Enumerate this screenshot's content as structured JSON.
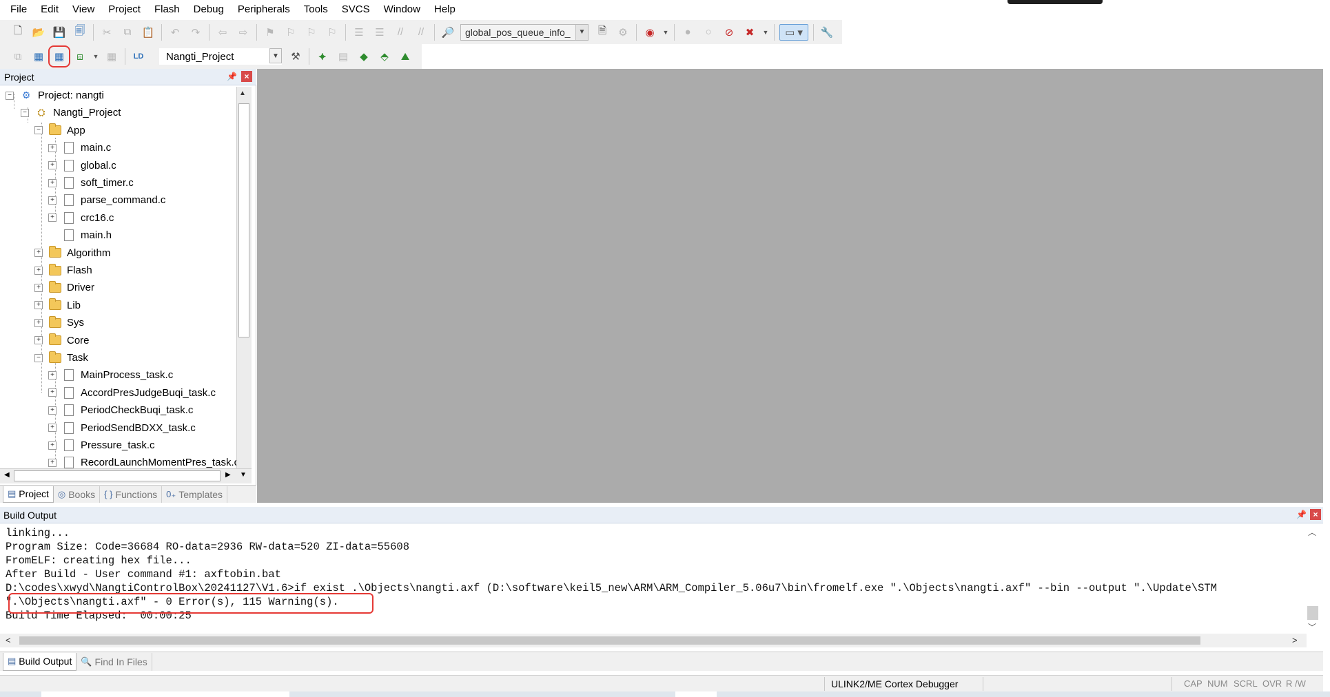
{
  "menu": [
    "File",
    "Edit",
    "View",
    "Project",
    "Flash",
    "Debug",
    "Peripherals",
    "Tools",
    "SVCS",
    "Window",
    "Help"
  ],
  "toolbar": {
    "find_combo_value": "global_pos_queue_info_",
    "target_combo_value": "Nangti_Project"
  },
  "project_panel": {
    "title": "Project",
    "tree": [
      {
        "label": "Project: nangti",
        "depth": 0,
        "type": "project",
        "exp": "−"
      },
      {
        "label": "Nangti_Project",
        "depth": 1,
        "type": "target",
        "exp": "−"
      },
      {
        "label": "App",
        "depth": 2,
        "type": "folder-open",
        "exp": "−"
      },
      {
        "label": "main.c",
        "depth": 3,
        "type": "file",
        "exp": "+"
      },
      {
        "label": "global.c",
        "depth": 3,
        "type": "file",
        "exp": "+"
      },
      {
        "label": "soft_timer.c",
        "depth": 3,
        "type": "file",
        "exp": "+"
      },
      {
        "label": "parse_command.c",
        "depth": 3,
        "type": "file",
        "exp": "+"
      },
      {
        "label": "crc16.c",
        "depth": 3,
        "type": "file",
        "exp": "+"
      },
      {
        "label": "main.h",
        "depth": 3,
        "type": "file",
        "exp": ""
      },
      {
        "label": "Algorithm",
        "depth": 2,
        "type": "folder",
        "exp": "+"
      },
      {
        "label": "Flash",
        "depth": 2,
        "type": "folder",
        "exp": "+"
      },
      {
        "label": "Driver",
        "depth": 2,
        "type": "folder",
        "exp": "+"
      },
      {
        "label": "Lib",
        "depth": 2,
        "type": "folder",
        "exp": "+"
      },
      {
        "label": "Sys",
        "depth": 2,
        "type": "folder",
        "exp": "+"
      },
      {
        "label": "Core",
        "depth": 2,
        "type": "folder",
        "exp": "+"
      },
      {
        "label": "Task",
        "depth": 2,
        "type": "folder-open",
        "exp": "−"
      },
      {
        "label": "MainProcess_task.c",
        "depth": 3,
        "type": "file",
        "exp": "+"
      },
      {
        "label": "AccordPresJudgeBuqi_task.c",
        "depth": 3,
        "type": "file",
        "exp": "+"
      },
      {
        "label": "PeriodCheckBuqi_task.c",
        "depth": 3,
        "type": "file",
        "exp": "+"
      },
      {
        "label": "PeriodSendBDXX_task.c",
        "depth": 3,
        "type": "file",
        "exp": "+"
      },
      {
        "label": "Pressure_task.c",
        "depth": 3,
        "type": "file",
        "exp": "+"
      },
      {
        "label": "RecordLaunchMomentPres_task.c",
        "depth": 3,
        "type": "file",
        "exp": "+"
      }
    ],
    "tabs": [
      {
        "label": "Project",
        "icon": "{}",
        "active": true
      },
      {
        "label": "Books",
        "icon": "books",
        "active": false
      },
      {
        "label": "Functions",
        "icon": "{}",
        "active": false
      },
      {
        "label": "Templates",
        "icon": "0+",
        "active": false
      }
    ]
  },
  "build_output": {
    "title": "Build Output",
    "lines": [
      "linking...",
      "Program Size: Code=36684 RO-data=2936 RW-data=520 ZI-data=55608",
      "FromELF: creating hex file...",
      "After Build - User command #1: axftobin.bat",
      "D:\\codes\\xwyd\\NangtiControlBox\\20241127\\V1.6>if exist .\\Objects\\nangti.axf (D:\\software\\keil5_new\\ARM\\ARM_Compiler_5.06u7\\bin\\fromelf.exe \".\\Objects\\nangti.axf\" --bin --output \".\\Update\\STM",
      "\".\\Objects\\nangti.axf\" - 0 Error(s), 115 Warning(s).",
      "Build Time Elapsed:  00:00:25"
    ],
    "tabs": [
      {
        "label": "Build Output",
        "active": true
      },
      {
        "label": "Find In Files",
        "active": false
      }
    ]
  },
  "status_bar": {
    "debugger": "ULINK2/ME Cortex Debugger",
    "indicators": [
      "CAP",
      "NUM",
      "SCRL",
      "OVR",
      "R /W"
    ]
  }
}
